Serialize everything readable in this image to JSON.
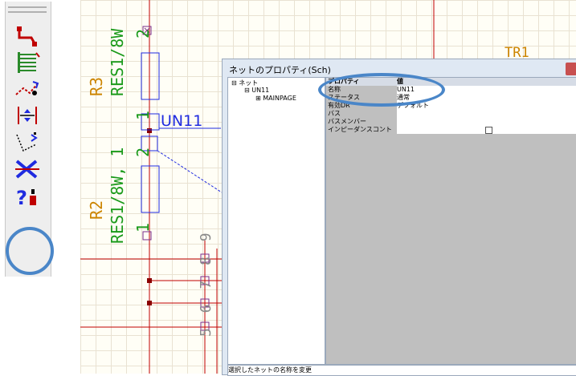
{
  "schematic": {
    "ref_r3": "R3",
    "val_r3": "RES1/8W",
    "ref_r2": "R2",
    "val_r2": "RES1/8W, 1",
    "pin_2_top": "2",
    "pin_1_mid": "1",
    "pin_2_mid": "2",
    "pin_1_bottom": "1",
    "net_label": "UN11",
    "pins_right": "5 6 7 8 9",
    "ref_partial": "TR1"
  },
  "dialog": {
    "title": "ネットのプロパティ(Sch)",
    "tree": {
      "root": "ネット",
      "child": "UN11",
      "grandchild": "MAINPAGE"
    },
    "grid": {
      "header_property": "プロパティ",
      "header_value": "値",
      "rows": [
        {
          "name": "名称",
          "value": "UN11"
        },
        {
          "name": "ステータス",
          "value": "通常"
        },
        {
          "name": "有効DR",
          "value": "デフォルト"
        },
        {
          "name": "バス",
          "value": ""
        },
        {
          "name": "バスメンバー",
          "value": ""
        },
        {
          "name": "インピーダンスコント",
          "value": ""
        }
      ]
    },
    "status_text": "選択したネットの名称を変更"
  },
  "toolbar": {
    "icons": [
      "route-icon",
      "bus-icon",
      "net-connect-icon",
      "align-icon",
      "rubber-band-icon",
      "delete-net-icon",
      "net-properties-icon"
    ]
  },
  "colors": {
    "highlight": "#4a86c8",
    "net_wire": "#1f2be0",
    "pin_wire": "#c00000",
    "ref_text": "#cc8400",
    "value_text": "#1a9a1a"
  }
}
